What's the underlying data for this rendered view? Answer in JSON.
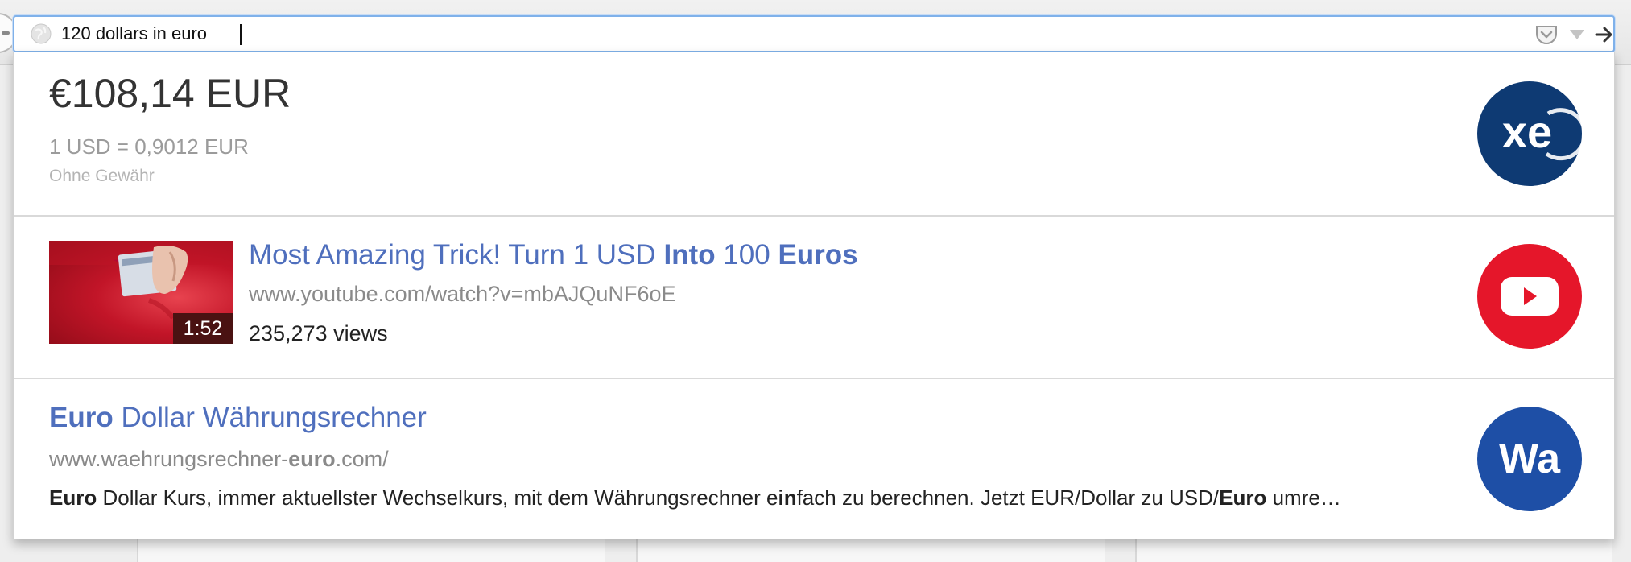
{
  "urlbar": {
    "value": "120 dollars in euro",
    "icons": {
      "site": "globe-icon",
      "pocket": "pocket-icon",
      "dropmarker": "dropmarker-icon",
      "go": "go-arrow-icon"
    }
  },
  "conversion": {
    "amount": "€108,14 EUR",
    "rate": "1 USD = 0,9012 EUR",
    "disclaimer": "Ohne Gewähr",
    "badge": "xe",
    "badge_color": "#0e3a73"
  },
  "video": {
    "title_parts": [
      "Most Amazing Trick! Turn 1 USD ",
      "Into",
      " 100 ",
      "Euros"
    ],
    "url": "www.youtube.com/watch?v=mbAJQuNF6oE",
    "views": "235,273 views",
    "duration": "1:52",
    "badge_icon": "youtube-play-icon",
    "badge_color": "#e5162a"
  },
  "result": {
    "title_parts": [
      "Euro",
      " Dollar Währungsrechner"
    ],
    "url_parts": [
      "www.waehrungsrechner-",
      "euro",
      ".com/"
    ],
    "snippet_parts": [
      "Euro",
      " Dollar Kurs, immer aktuellster Wechselkurs, mit dem Währungsrechner e",
      "in",
      "fach zu berechnen. Jetzt EUR/Dollar zu USD/",
      "Euro",
      " umre…"
    ],
    "badge": "Wa",
    "badge_color": "#1e4fa6"
  },
  "colors": {
    "link": "#4f6fbd",
    "url_gray": "#8a8a8a",
    "focus_ring": "#7fb1ea"
  }
}
